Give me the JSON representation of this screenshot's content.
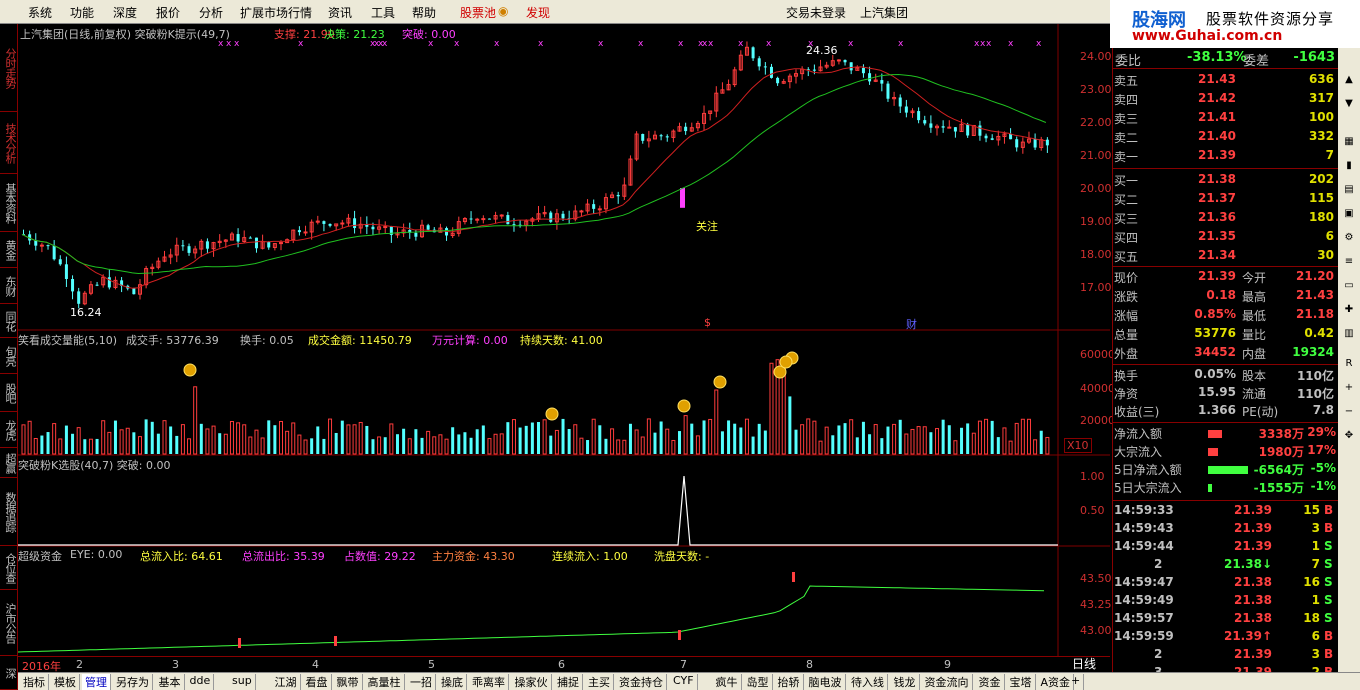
{
  "menu": {
    "items": [
      "系统",
      "功能",
      "深度",
      "报价",
      "分析",
      "扩展市场行情",
      "资讯",
      "工具",
      "帮助"
    ],
    "red_items": [
      "股票池",
      "发现"
    ],
    "status": "交易未登录",
    "stock_name": "上汽集团"
  },
  "logo": {
    "site": "股海网",
    "tagline": "股票软件资源分享",
    "url": "www.Guhai.com.cn"
  },
  "left_tabs": [
    "分时走势",
    "技术分析",
    "基本资料",
    "黄金",
    "东财",
    "同花",
    "旬亮",
    "股吧",
    "龙虎",
    "超赢",
    "数据追踪",
    "仓位查",
    "沪市公告",
    "深"
  ],
  "main_chart": {
    "title": "上汽集团(日线,前复权) 突破粉K提示(49,7)",
    "support_label": "支撑: 21.90",
    "decision_label": "决策: 21.23",
    "breakout_label": "突破: 0.00",
    "high_label": "24.36",
    "low_label": "16.24",
    "attention_label": "关注",
    "marks": [
      "$",
      "财"
    ],
    "y_ticks": [
      "24.00",
      "23.00",
      "22.00",
      "21.00",
      "20.00",
      "19.00",
      "18.00",
      "17.00"
    ],
    "colors": {
      "up": "#ff3c3c",
      "down": "#54ffff",
      "ma_red": "#d02020",
      "ma_green": "#20c020",
      "pink": "#ff40ff"
    }
  },
  "volume_chart": {
    "title": "笑看成交量能(5,10)",
    "vol": "成交手: 53776.39",
    "turnover": "换手: 0.05",
    "amount": "成交金额: 11450.79",
    "wan": "万元计算: 0.00",
    "days": "持续天数: 41.00",
    "y_ticks": [
      "60000",
      "40000",
      "20000"
    ],
    "unit": "X10"
  },
  "pink_chart": {
    "title": "突破粉K选股(40,7) 突破: 0.00",
    "y_ticks": [
      "1.00",
      "0.50"
    ]
  },
  "fund_chart": {
    "title": "超级资金",
    "eye": "EYE: 0.00",
    "in_ratio": "总流入比: 64.61",
    "out_ratio": "总流出比: 35.39",
    "share": "占数值: 29.22",
    "main": "主力资金: 43.30",
    "cont": "连续流入: 1.00",
    "wash": "洗盘天数: -",
    "y_ticks": [
      "43.50",
      "43.25",
      "43.00"
    ]
  },
  "date_axis": {
    "labels": [
      "2016年",
      "2",
      "3",
      "4",
      "5",
      "6",
      "7",
      "8",
      "9"
    ],
    "period": "日线"
  },
  "quote": {
    "committee": {
      "l": "委比",
      "m": "-38.13%",
      "r2l": "委差",
      "r": "-1643"
    },
    "sells": [
      {
        "l": "卖五",
        "p": "21.43",
        "v": "636"
      },
      {
        "l": "卖四",
        "p": "21.42",
        "v": "317"
      },
      {
        "l": "卖三",
        "p": "21.41",
        "v": "100"
      },
      {
        "l": "卖二",
        "p": "21.40",
        "v": "332"
      },
      {
        "l": "卖一",
        "p": "21.39",
        "v": "7"
      }
    ],
    "buys": [
      {
        "l": "买一",
        "p": "21.38",
        "v": "202"
      },
      {
        "l": "买二",
        "p": "21.37",
        "v": "115"
      },
      {
        "l": "买三",
        "p": "21.36",
        "v": "180"
      },
      {
        "l": "买四",
        "p": "21.35",
        "v": "6"
      },
      {
        "l": "买五",
        "p": "21.34",
        "v": "30"
      }
    ],
    "stats": [
      {
        "l": "现价",
        "v": "21.39",
        "l2": "今开",
        "v2": "21.20"
      },
      {
        "l": "涨跌",
        "v": "0.18",
        "l2": "最高",
        "v2": "21.43"
      },
      {
        "l": "涨幅",
        "v": "0.85%",
        "l2": "最低",
        "v2": "21.18"
      },
      {
        "l": "总量",
        "v": "53776",
        "l2": "量比",
        "v2": "0.42"
      },
      {
        "l": "外盘",
        "v": "34452",
        "l2": "内盘",
        "v2": "19324"
      }
    ],
    "stats2": [
      {
        "l": "换手",
        "v": "0.05%",
        "l2": "股本",
        "v2": "110亿"
      },
      {
        "l": "净资",
        "v": "15.95",
        "l2": "流通",
        "v2": "110亿"
      },
      {
        "l": "收益(三)",
        "v": "1.366",
        "l2": "PE(动)",
        "v2": "7.8"
      }
    ],
    "flows": [
      {
        "l": "净流入额",
        "v": "3338万",
        "p": "29%"
      },
      {
        "l": "大宗流入",
        "v": "1980万",
        "p": "17%"
      },
      {
        "l": "5日净流入额",
        "v": "-6564万",
        "p": "-5%"
      },
      {
        "l": "5日大宗流入",
        "v": "-1555万",
        "p": "-1%"
      }
    ],
    "ticks": [
      {
        "t": "14:59:33",
        "p": "21.39",
        "v": "15",
        "s": "B"
      },
      {
        "t": "14:59:43",
        "p": "21.39",
        "v": "3",
        "s": "B"
      },
      {
        "t": "14:59:44",
        "p": "21.39",
        "v": "1",
        "s": "S"
      },
      {
        "t": "2",
        "p": "21.38↓",
        "v": "7",
        "s": "S"
      },
      {
        "t": "14:59:47",
        "p": "21.38",
        "v": "16",
        "s": "S"
      },
      {
        "t": "14:59:49",
        "p": "21.38",
        "v": "1",
        "s": "S"
      },
      {
        "t": "14:59:57",
        "p": "21.38",
        "v": "18",
        "s": "S"
      },
      {
        "t": "14:59:59",
        "p": "21.39↑",
        "v": "6",
        "s": "B"
      },
      {
        "t": "2",
        "p": "21.39",
        "v": "3",
        "s": "B"
      },
      {
        "t": "3",
        "p": "21.39",
        "v": "2",
        "s": "B"
      }
    ]
  },
  "bottom_tabs": [
    "指标",
    "模板",
    "管理",
    "另存为",
    "基本",
    "dde",
    "sup",
    "江湖",
    "看盘",
    "飘带",
    "高量柱",
    "一招",
    "操底",
    "乖离率",
    "操家伙",
    "捕捉",
    "主买",
    "资金持仓",
    "CYF",
    "疯牛",
    "岛型",
    "抬轿",
    "脑电波",
    "待入线",
    "钱龙",
    "资金流向",
    "资金",
    "宝塔",
    "A资金"
  ],
  "bottom_selected": "管理"
}
